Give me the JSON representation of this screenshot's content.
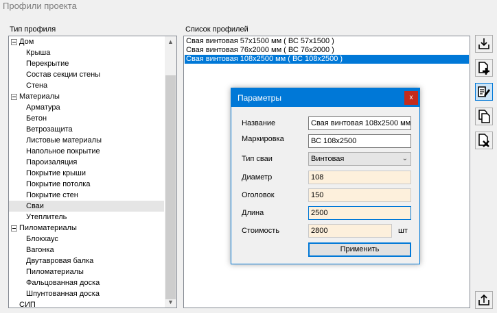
{
  "window": {
    "title": "Профили проекта"
  },
  "tree": {
    "label": "Тип профиля",
    "items": [
      {
        "text": "Дом",
        "level": 0,
        "expanded": true
      },
      {
        "text": "Крыша",
        "level": 1
      },
      {
        "text": "Перекрытие",
        "level": 1
      },
      {
        "text": "Состав секции стены",
        "level": 1
      },
      {
        "text": "Стена",
        "level": 1
      },
      {
        "text": "Материалы",
        "level": 0,
        "expanded": true
      },
      {
        "text": "Арматура",
        "level": 1
      },
      {
        "text": "Бетон",
        "level": 1
      },
      {
        "text": "Ветрозащита",
        "level": 1
      },
      {
        "text": "Листовые материалы",
        "level": 1
      },
      {
        "text": "Напольное покрытие",
        "level": 1
      },
      {
        "text": "Пароизаляция",
        "level": 1
      },
      {
        "text": "Покрытие крыши",
        "level": 1
      },
      {
        "text": "Покрытие потолка",
        "level": 1
      },
      {
        "text": "Покрытие стен",
        "level": 1
      },
      {
        "text": "Сваи",
        "level": 1,
        "selected": true
      },
      {
        "text": "Утеплитель",
        "level": 1
      },
      {
        "text": "Пиломатериалы",
        "level": 0,
        "expanded": true
      },
      {
        "text": "Блокхаус",
        "level": 1
      },
      {
        "text": "Вагонка",
        "level": 1
      },
      {
        "text": "Двутавровая балка",
        "level": 1
      },
      {
        "text": "Пиломатериалы",
        "level": 1
      },
      {
        "text": "Фальцованная доска",
        "level": 1
      },
      {
        "text": "Шпунтованная доска",
        "level": 1
      },
      {
        "text": "СИП",
        "level": 0
      }
    ]
  },
  "profiles": {
    "label": "Список профилей",
    "items": [
      {
        "text": "Свая винтовая 57x1500 мм ( ВС 57x1500 )"
      },
      {
        "text": "Свая винтовая 76x2000 мм ( ВС 76x2000 )"
      },
      {
        "text": "Свая винтовая 108x2500 мм ( ВС 108x2500 )",
        "selected": true
      }
    ]
  },
  "toolbar": {
    "icons": [
      "import-icon",
      "add-icon",
      "edit-icon",
      "copy-icon",
      "delete-icon",
      "export-icon"
    ]
  },
  "dialog": {
    "title": "Параметры",
    "close_glyph": "x",
    "fields": {
      "name_label": "Название",
      "name_value": "Свая винтовая 108x2500 мм",
      "marking_label": "Маркировка",
      "marking_value": "ВС 108x2500",
      "type_label": "Тип сваи",
      "type_value": "Винтовая",
      "diameter_label": "Диаметр",
      "diameter_value": "108",
      "head_label": "Оголовок",
      "head_value": "150",
      "length_label": "Длина",
      "length_value": "2500",
      "cost_label": "Стоимость",
      "cost_value": "2800",
      "cost_unit": "шт"
    },
    "apply_label": "Применить"
  },
  "colors": {
    "accent": "#0078d7",
    "selection_bg": "#0078d7",
    "numeric_field_bg": "#fdf0dc",
    "close_button": "#c42b1c"
  }
}
